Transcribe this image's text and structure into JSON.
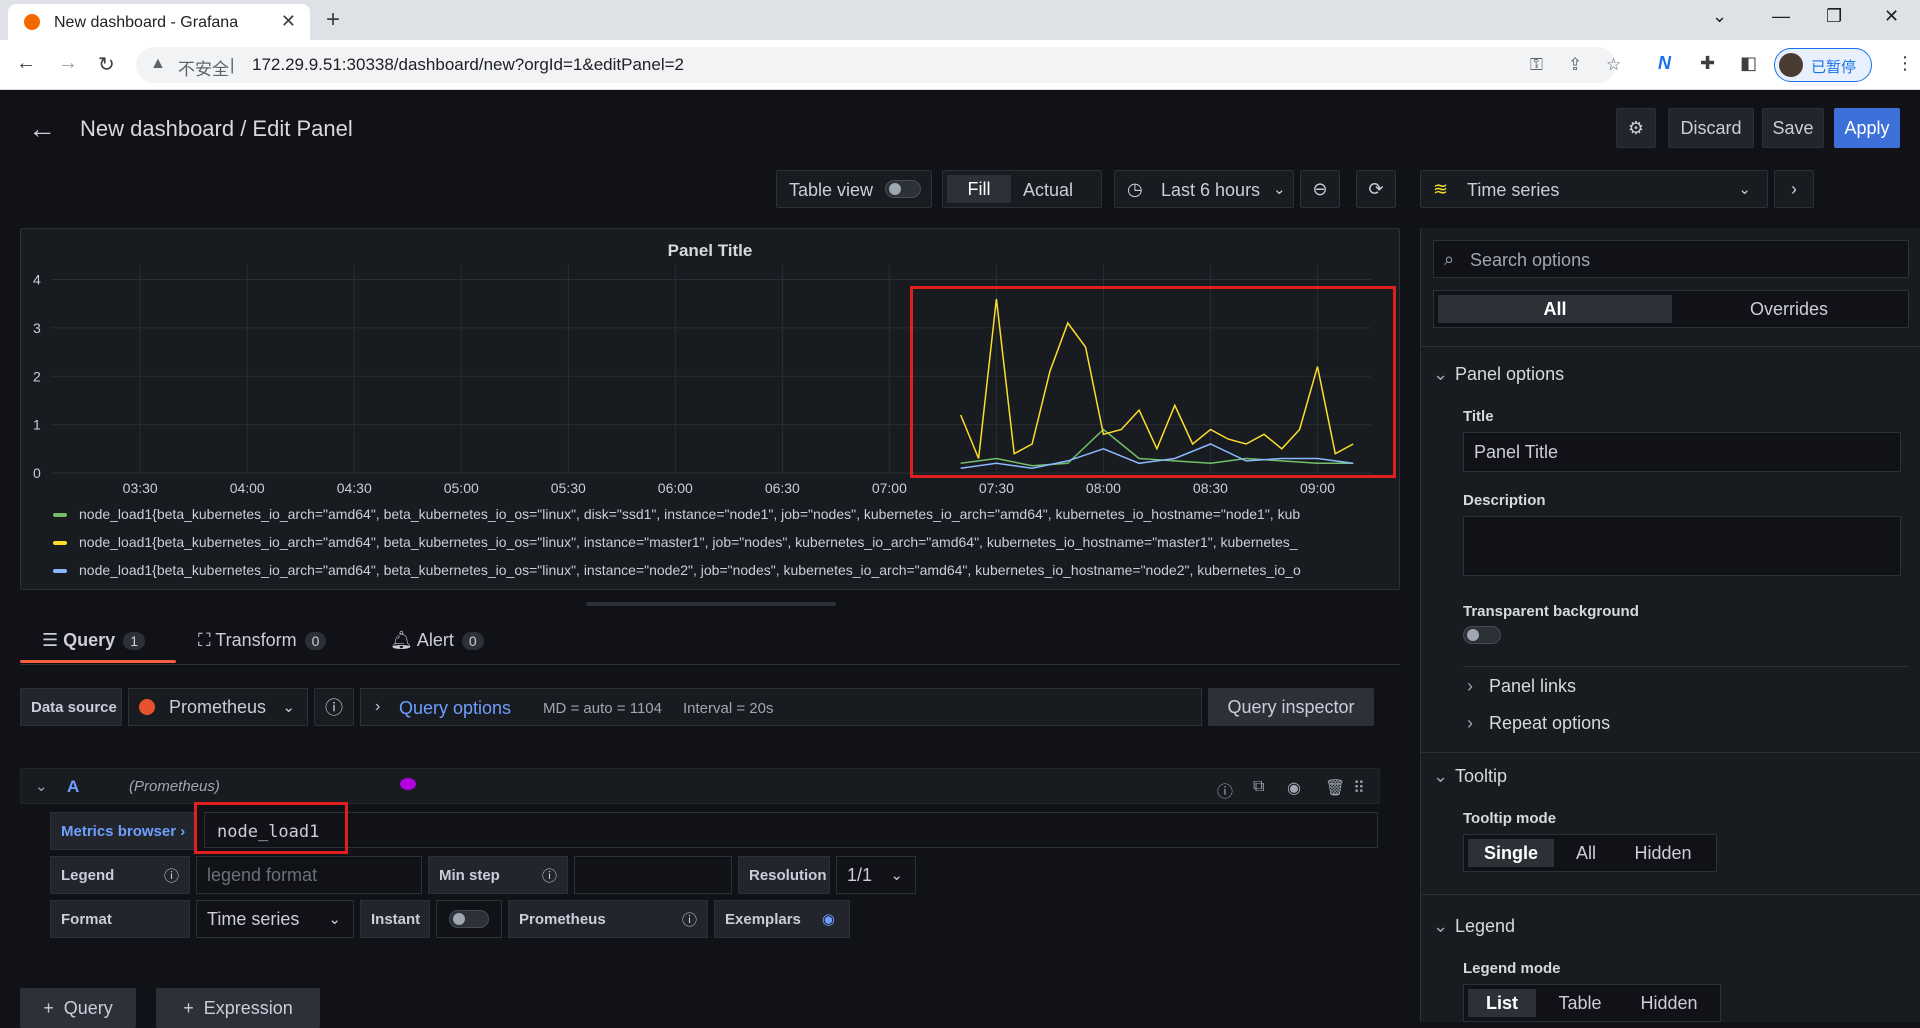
{
  "browser": {
    "tab_title": "New dashboard - Grafana",
    "insecure_label": "不安全",
    "url": "172.29.9.51:30338/dashboard/new?orgId=1&editPanel=2",
    "profile_label": "已暂停"
  },
  "header": {
    "title": "New dashboard / Edit Panel",
    "discard": "Discard",
    "save": "Save",
    "apply": "Apply"
  },
  "toolbar": {
    "table_view": "Table view",
    "fill": "Fill",
    "actual": "Actual",
    "time_range": "Last 6 hours"
  },
  "panel": {
    "title": "Panel Title"
  },
  "chart_data": {
    "type": "line",
    "title": "Panel Title",
    "y_ticks": [
      "0",
      "1",
      "2",
      "3",
      "4"
    ],
    "ylim": [
      0,
      4.3
    ],
    "x_ticks": [
      "03:30",
      "04:00",
      "04:30",
      "05:00",
      "05:30",
      "06:00",
      "06:30",
      "07:00",
      "07:30",
      "08:00",
      "08:30",
      "09:00"
    ],
    "x_range": [
      "03:05",
      "09:15"
    ],
    "data_start": "07:20",
    "series": [
      {
        "name": "node_load1{beta_kubernetes_io_arch=\"amd64\", beta_kubernetes_io_os=\"linux\", disk=\"ssd1\", instance=\"node1\", job=\"nodes\", kubernetes_io_arch=\"amd64\", kubernetes_io_hostname=\"node1\", kub",
        "color": "#73bf69",
        "x": [
          "07:20",
          "07:30",
          "07:40",
          "07:50",
          "08:00",
          "08:10",
          "08:20",
          "08:30",
          "08:40",
          "08:50",
          "09:00",
          "09:10"
        ],
        "values": [
          0.2,
          0.3,
          0.15,
          0.2,
          0.9,
          0.3,
          0.25,
          0.2,
          0.3,
          0.25,
          0.2,
          0.2
        ]
      },
      {
        "name": "node_load1{beta_kubernetes_io_arch=\"amd64\", beta_kubernetes_io_os=\"linux\", instance=\"master1\", job=\"nodes\", kubernetes_io_arch=\"amd64\", kubernetes_io_hostname=\"master1\", kubernetes_",
        "color": "#fade2a",
        "x": [
          "07:20",
          "07:25",
          "07:30",
          "07:35",
          "07:40",
          "07:45",
          "07:50",
          "07:55",
          "08:00",
          "08:05",
          "08:10",
          "08:15",
          "08:20",
          "08:25",
          "08:30",
          "08:35",
          "08:40",
          "08:45",
          "08:50",
          "08:55",
          "09:00",
          "09:05",
          "09:10"
        ],
        "values": [
          1.2,
          0.3,
          3.6,
          0.4,
          0.6,
          2.1,
          3.1,
          2.6,
          0.8,
          0.9,
          1.3,
          0.5,
          1.4,
          0.6,
          0.9,
          0.7,
          0.6,
          0.8,
          0.5,
          0.9,
          2.2,
          0.4,
          0.6
        ]
      },
      {
        "name": "node_load1{beta_kubernetes_io_arch=\"amd64\", beta_kubernetes_io_os=\"linux\", instance=\"node2\", job=\"nodes\", kubernetes_io_arch=\"amd64\", kubernetes_io_hostname=\"node2\", kubernetes_io_o",
        "color": "#8ab8ff",
        "x": [
          "07:20",
          "07:30",
          "07:40",
          "07:50",
          "08:00",
          "08:10",
          "08:20",
          "08:30",
          "08:40",
          "08:50",
          "09:00",
          "09:10"
        ],
        "values": [
          0.1,
          0.2,
          0.1,
          0.25,
          0.5,
          0.2,
          0.3,
          0.6,
          0.25,
          0.3,
          0.3,
          0.2
        ]
      }
    ],
    "grid": true,
    "legend": "bottom"
  },
  "query_tabs": {
    "query": "Query",
    "query_count": "1",
    "transform": "Transform",
    "transform_count": "0",
    "alert": "Alert",
    "alert_count": "0"
  },
  "query": {
    "data_source_label": "Data source",
    "data_source": "Prometheus",
    "query_options": "Query options",
    "md": "MD = auto = 1104",
    "interval": "Interval = 20s",
    "inspector": "Query inspector",
    "ref_id": "A",
    "ref_ds": "(Prometheus)",
    "metrics_browser": "Metrics browser",
    "expr": "node_load1",
    "legend_label": "Legend",
    "legend_placeholder": "legend format",
    "min_step_label": "Min step",
    "resolution_label": "Resolution",
    "resolution": "1/1",
    "format_label": "Format",
    "format": "Time series",
    "instant_label": "Instant",
    "prometheus_label": "Prometheus",
    "exemplars_label": "Exemplars",
    "add_query": "Query",
    "add_expression": "Expression"
  },
  "options": {
    "visualization": "Time series",
    "search_placeholder": "Search options",
    "tab_all": "All",
    "tab_overrides": "Overrides",
    "panel_options": "Panel options",
    "title_label": "Title",
    "title_value": "Panel Title",
    "description_label": "Description",
    "transparent_label": "Transparent background",
    "panel_links": "Panel links",
    "repeat_options": "Repeat options",
    "tooltip": "Tooltip",
    "tooltip_mode": "Tooltip mode",
    "tooltip_single": "Single",
    "tooltip_all": "All",
    "tooltip_hidden": "Hidden",
    "legend": "Legend",
    "legend_mode": "Legend mode",
    "legend_list": "List",
    "legend_table": "Table",
    "legend_hidden": "Hidden"
  }
}
